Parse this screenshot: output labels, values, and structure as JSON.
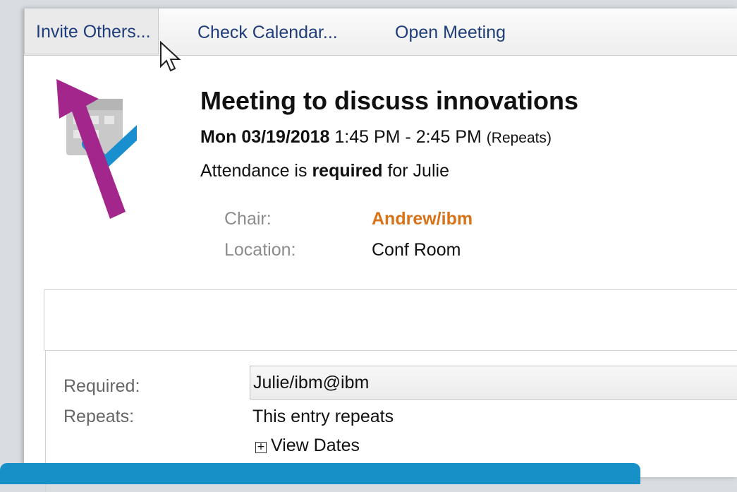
{
  "toolbar": {
    "invite_label": "Invite Others...",
    "check_calendar_label": "Check Calendar...",
    "open_meeting_label": "Open Meeting"
  },
  "meeting": {
    "title": "Meeting to discuss innovations",
    "date": "Mon 03/19/2018",
    "time": "1:45 PM - 2:45 PM",
    "repeats_note": "(Repeats)",
    "attendance_prefix": "Attendance is",
    "attendance_status": "required",
    "attendance_suffix": "for Julie",
    "chair_label": "Chair:",
    "chair_value": "Andrew/ibm",
    "location_label": "Location:",
    "location_value": "Conf Room"
  },
  "details": {
    "required_label": "Required:",
    "required_value": "Julie/ibm@ibm",
    "repeats_label": "Repeats:",
    "repeats_value": "This entry repeats",
    "view_dates_label": "View Dates"
  },
  "colors": {
    "chair_link": "#d9731a",
    "annotation_arrow": "#a3268c",
    "banner": "#1790c8",
    "checkmark": "#1a8fd0"
  },
  "icons": {
    "meeting_icon": "calendar-check-icon",
    "view_dates_icon": "expand-plus-icon"
  }
}
